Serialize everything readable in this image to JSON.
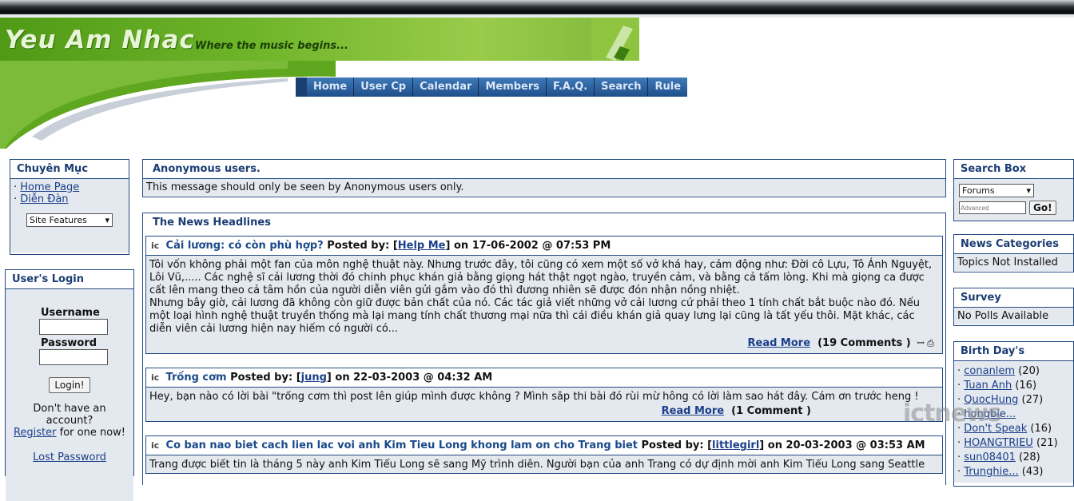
{
  "banner": {
    "title": "Yeu Am Nhac",
    "subtitle": "Where the music begins..."
  },
  "nav": [
    "Home",
    "User Cp",
    "Calendar",
    "Members",
    "F.A.Q.",
    "Search",
    "Rule"
  ],
  "left": {
    "chuyen_muc": {
      "title": "Chuyên Mục",
      "links": [
        "Home Page",
        "Diễn Đàn"
      ],
      "select_value": "Site Features"
    },
    "login": {
      "title": "User's Login",
      "username_label": "Username",
      "password_label": "Password",
      "button": "Login!",
      "no_account": "Don't have an account?",
      "register": "Register",
      "register_suffix": "for one now!",
      "lost": "Lost Password"
    }
  },
  "center": {
    "anon": {
      "title": "Anonymous users.",
      "message": "This message should only be seen by Anonymous users only."
    },
    "news_title": "The News Headlines",
    "posts": [
      {
        "title": "Cải lương: có còn phù hợp?",
        "posted_by_label": "Posted by: [",
        "author": "Help Me",
        "date": "] on 17-06-2002 @ 07:53 PM",
        "body": "Tôi vốn không phải một fan của môn nghệ thuật này. Nhưng trước đây, tôi cũng có xem một số vở khá hay, cảm động như: Đời cô Lựu, Tô Ánh Nguyệt, Lôi Vũ,..... Các nghệ sĩ cải lương thời đó chinh phục khán giả bằng giọng hát thật ngọt ngào, truyền cảm, và bằng cả tấm lòng. Khi mà giọng ca được cất lên mang theo cả tâm hồn của người diễn viên gửi gắm vào đó thì đương nhiên sẽ được đón nhận nồng nhiệt.",
        "body2": "Nhưng bây giờ, cải lương đã không còn giữ được bản chất của nó. Các tác giả viết những vở cải lương cứ phải theo 1 tính chất bắt buộc nào đó. Nếu một loại hình nghệ thuật truyền thống mà lại mang tính chất thương mại nữa thì cái điều khán giả quay lưng lại cũng là tất yếu thôi. Mặt khác, các diễn viên cải lương hiện nay hiếm có người có...",
        "read_more": "Read More",
        "comments": "(19 Comments )"
      },
      {
        "title": "Trống cơm",
        "posted_by_label": "Posted by: [",
        "author": "jung",
        "date": "] on 22-03-2003 @ 04:32 AM",
        "body": "Hey, bạn nào có lời bài \"trống cơm thì post lên giúp mình được không ? Mình sắp thi bài đó rùi mừ hông có lời làm sao hát đây. Cám ơn trước heng !",
        "read_more": "Read More",
        "comments": "(1 Comment )"
      },
      {
        "title": "Co ban nao biet cach lien lac voi anh Kim Tieu Long khong lam on cho Trang biet",
        "posted_by_label": "Posted by: [",
        "author": "littlegirl",
        "date": "] on 20-03-2003 @ 03:53 AM",
        "body": "Trang được biết tin là tháng 5 này anh Kim Tiểu Long sẽ sang Mỹ trình diễn. Người bạn của anh Trang có dự định mời anh Kim Tiểu Long sang Seattle"
      }
    ]
  },
  "right": {
    "search": {
      "title": "Search Box",
      "select_value": "Forums",
      "placeholder": "Advanced",
      "go": "Go!"
    },
    "news_categories": {
      "title": "News Categories",
      "text": "Topics Not Installed"
    },
    "survey": {
      "title": "Survey",
      "text": "No Polls Available"
    },
    "birthdays": {
      "title": "Birth Day's",
      "items": [
        {
          "name": "conanlem",
          "age": "(20)"
        },
        {
          "name": "Tuan Anh",
          "age": "(16)"
        },
        {
          "name": "QuocHung",
          "age": "(27)"
        },
        {
          "name": "hongbie...",
          "age": ""
        },
        {
          "name": "Don't Speak",
          "age": "(16)"
        },
        {
          "name": "HOANGTRIEU",
          "age": "(21)"
        },
        {
          "name": "sun08401",
          "age": "(28)"
        },
        {
          "name": "Trunghie...",
          "age": "(43)"
        }
      ]
    }
  },
  "watermark": "ictnews"
}
